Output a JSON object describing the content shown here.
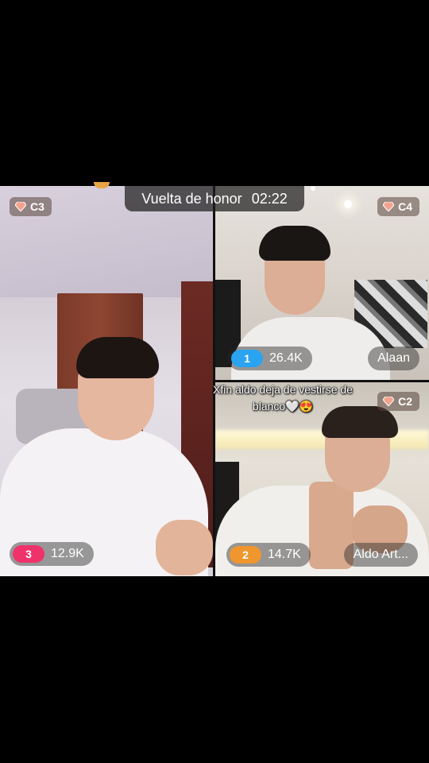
{
  "header": {
    "title": "Vuelta de honor",
    "timer": "02:22"
  },
  "caption": {
    "line1": "Xfin aldo deja de vestirse de",
    "line2": "blanco",
    "emojis": "🤍😍"
  },
  "panels": [
    {
      "id": "left",
      "level_badge": "C3",
      "rank": "3",
      "rank_color": "#f0326b",
      "score": "12.9K",
      "name": ""
    },
    {
      "id": "top-right",
      "level_badge": "C4",
      "rank": "1",
      "rank_color": "#2aa3f0",
      "score": "26.4K",
      "name": "Alaan"
    },
    {
      "id": "bottom-right",
      "level_badge": "C2",
      "rank": "2",
      "rank_color": "#f0962e",
      "score": "14.7K",
      "name": "Aldo Art..."
    }
  ],
  "icons": {
    "badge_icon": "diamond-icon",
    "gem_color": "#f2a38c"
  }
}
